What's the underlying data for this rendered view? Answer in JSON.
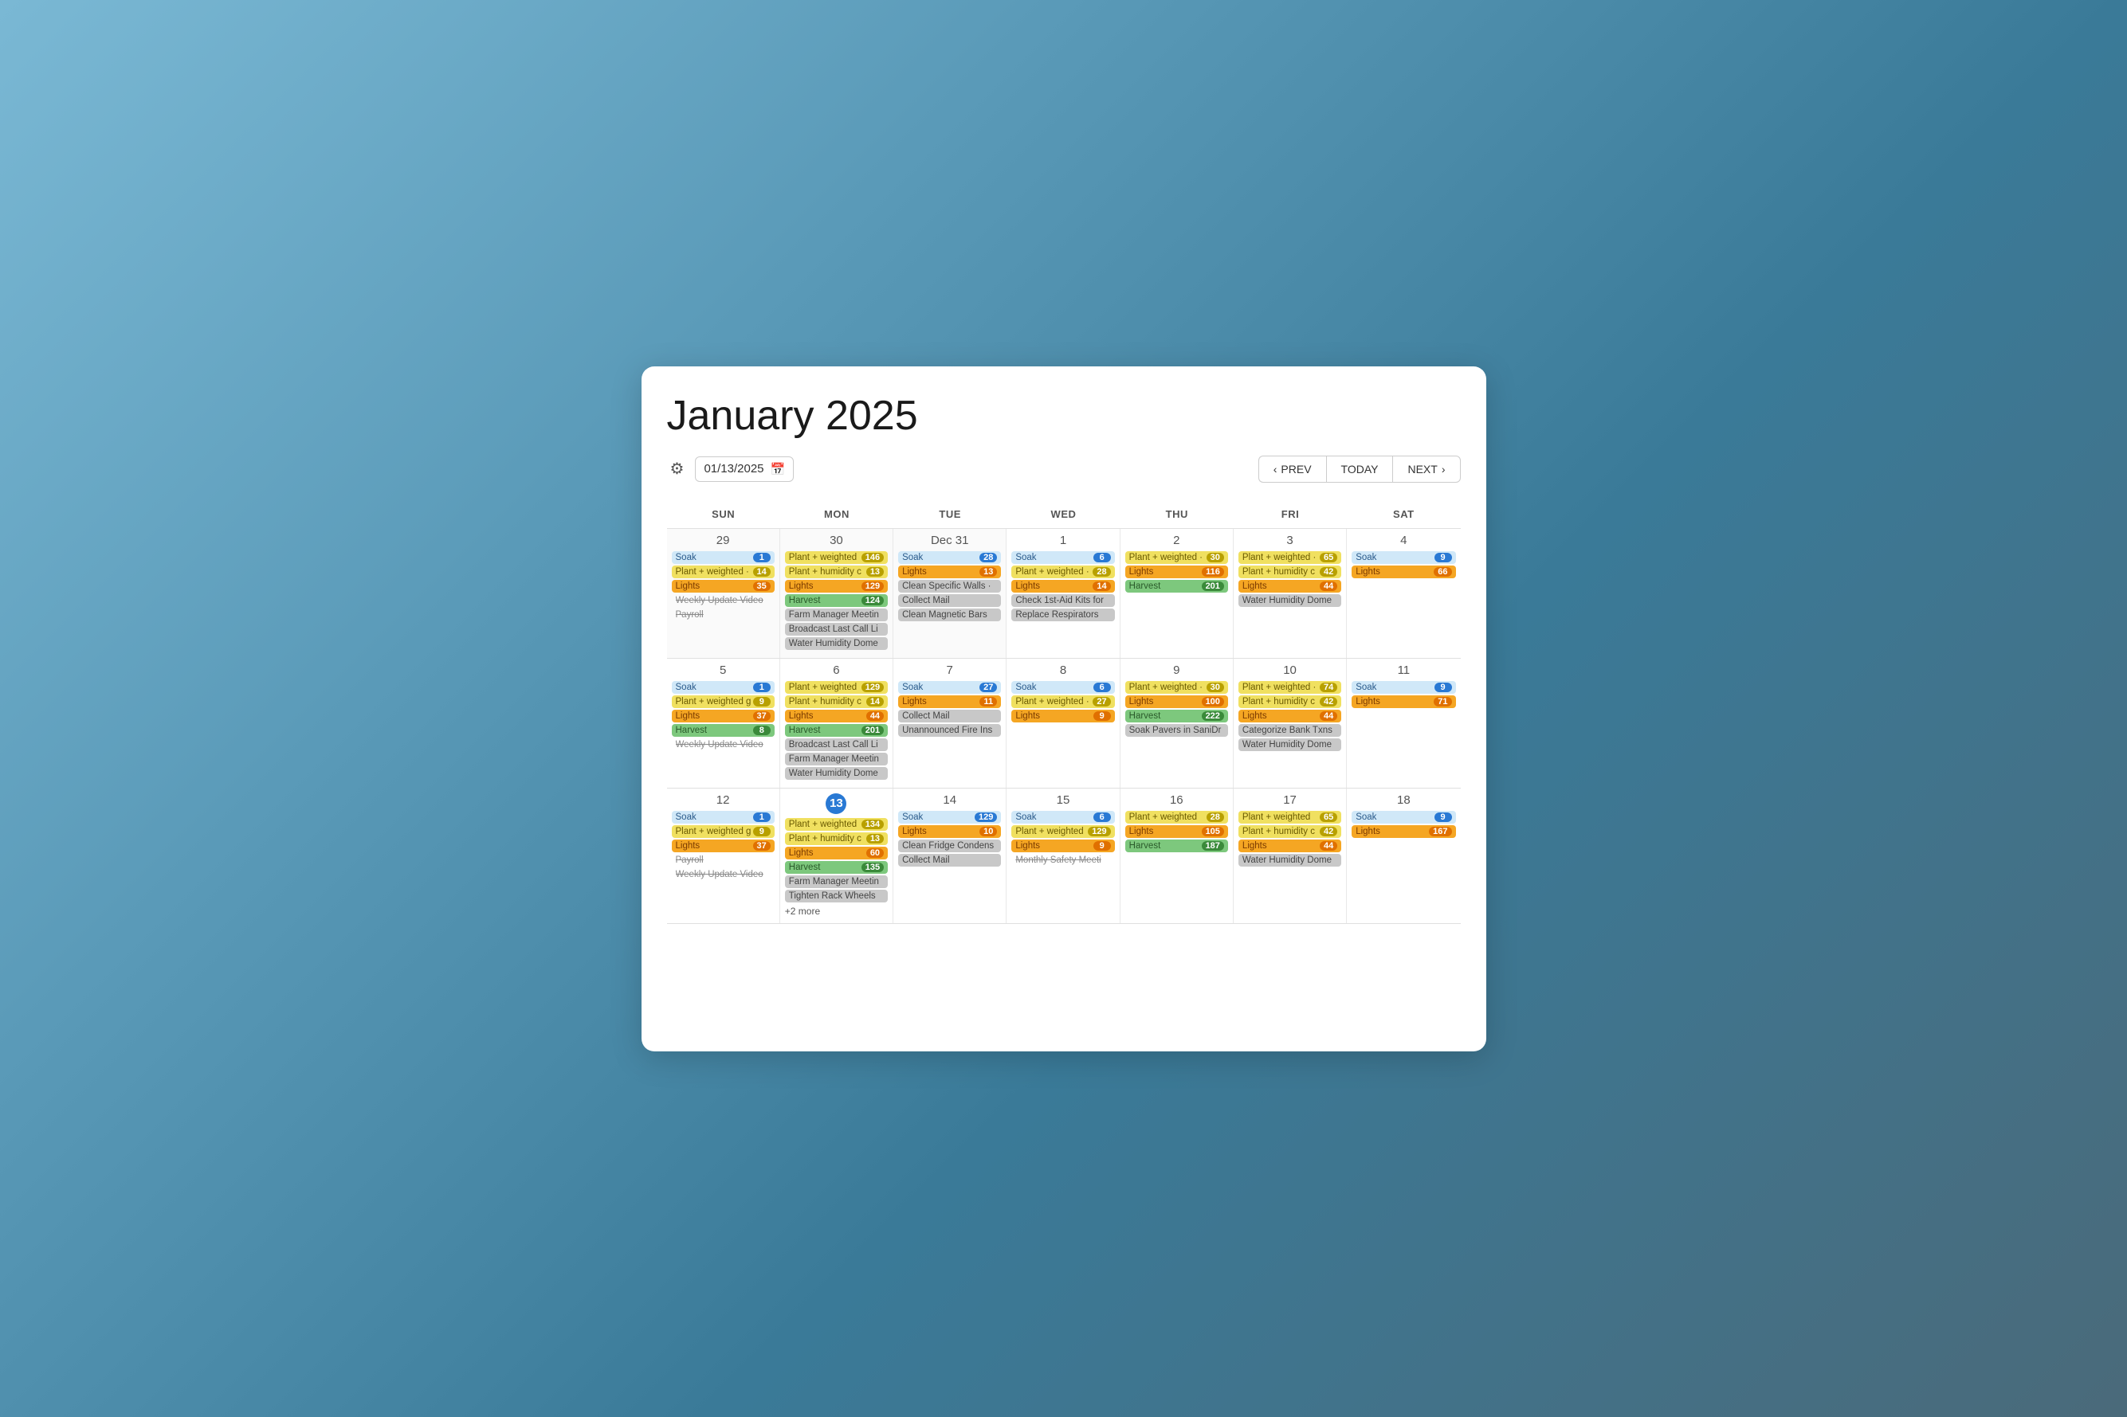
{
  "header": {
    "title": "January 2025",
    "date_input": "01/13/2025",
    "prev_label": "PREV",
    "today_label": "TODAY",
    "next_label": "NEXT"
  },
  "day_headers": [
    "SUN",
    "MON",
    "TUE",
    "WED",
    "THU",
    "FRI",
    "SAT"
  ],
  "weeks": [
    {
      "days": [
        {
          "num": "29",
          "other": true,
          "events": [
            {
              "name": "Soak",
              "badge": "1",
              "color": "blue",
              "badge_color": "blue-badge"
            },
            {
              "name": "Plant + weighted ·",
              "badge": "14",
              "color": "yellow",
              "badge_color": "yellow-badge"
            },
            {
              "name": "Lights",
              "badge": "35",
              "color": "orange",
              "badge_color": "orange-badge"
            },
            {
              "name": "Weekly Update Video",
              "badge": "",
              "color": "gray-text",
              "badge_color": ""
            },
            {
              "name": "Payroll",
              "badge": "",
              "color": "gray-text",
              "badge_color": ""
            }
          ]
        },
        {
          "num": "30",
          "other": true,
          "events": [
            {
              "name": "Plant + weighted",
              "badge": "146",
              "color": "yellow",
              "badge_color": "yellow-badge"
            },
            {
              "name": "Plant + humidity c",
              "badge": "13",
              "color": "yellow",
              "badge_color": "yellow-badge"
            },
            {
              "name": "Lights",
              "badge": "129",
              "color": "orange",
              "badge_color": "orange-badge"
            },
            {
              "name": "Harvest",
              "badge": "124",
              "color": "green",
              "badge_color": "green-badge"
            },
            {
              "name": "Farm Manager Meetin",
              "badge": "",
              "color": "gray",
              "badge_color": ""
            },
            {
              "name": "Broadcast Last Call Li",
              "badge": "",
              "color": "gray",
              "badge_color": ""
            },
            {
              "name": "Water Humidity Dome",
              "badge": "",
              "color": "gray",
              "badge_color": ""
            }
          ]
        },
        {
          "num": "Dec 31",
          "other": true,
          "events": [
            {
              "name": "Soak",
              "badge": "28",
              "color": "blue",
              "badge_color": "blue-badge"
            },
            {
              "name": "Lights",
              "badge": "13",
              "color": "orange",
              "badge_color": "orange-badge"
            },
            {
              "name": "Clean Specific Walls ·",
              "badge": "",
              "color": "gray",
              "badge_color": ""
            },
            {
              "name": "Collect Mail",
              "badge": "",
              "color": "gray",
              "badge_color": ""
            },
            {
              "name": "Clean Magnetic Bars",
              "badge": "",
              "color": "gray",
              "badge_color": ""
            }
          ]
        },
        {
          "num": "1",
          "other": false,
          "events": [
            {
              "name": "Soak",
              "badge": "6",
              "color": "blue",
              "badge_color": "blue-badge"
            },
            {
              "name": "Plant + weighted ·",
              "badge": "28",
              "color": "yellow",
              "badge_color": "yellow-badge"
            },
            {
              "name": "Lights",
              "badge": "14",
              "color": "orange",
              "badge_color": "orange-badge"
            },
            {
              "name": "Check 1st-Aid Kits for",
              "badge": "",
              "color": "gray",
              "badge_color": ""
            },
            {
              "name": "Replace Respirators",
              "badge": "",
              "color": "gray",
              "badge_color": ""
            }
          ]
        },
        {
          "num": "2",
          "other": false,
          "events": [
            {
              "name": "Plant + weighted ·",
              "badge": "30",
              "color": "yellow",
              "badge_color": "yellow-badge"
            },
            {
              "name": "Lights",
              "badge": "116",
              "color": "orange",
              "badge_color": "orange-badge"
            },
            {
              "name": "Harvest",
              "badge": "201",
              "color": "green",
              "badge_color": "green-badge"
            }
          ]
        },
        {
          "num": "3",
          "other": false,
          "events": [
            {
              "name": "Plant + weighted ·",
              "badge": "65",
              "color": "yellow",
              "badge_color": "yellow-badge"
            },
            {
              "name": "Plant + humidity c",
              "badge": "42",
              "color": "yellow",
              "badge_color": "yellow-badge"
            },
            {
              "name": "Lights",
              "badge": "44",
              "color": "orange",
              "badge_color": "orange-badge"
            },
            {
              "name": "Water Humidity Dome",
              "badge": "",
              "color": "gray",
              "badge_color": ""
            }
          ]
        },
        {
          "num": "4",
          "other": false,
          "events": [
            {
              "name": "Soak",
              "badge": "9",
              "color": "blue",
              "badge_color": "blue-badge"
            },
            {
              "name": "Lights",
              "badge": "66",
              "color": "orange",
              "badge_color": "orange-badge"
            }
          ]
        }
      ]
    },
    {
      "days": [
        {
          "num": "5",
          "other": false,
          "events": [
            {
              "name": "Soak",
              "badge": "1",
              "color": "blue",
              "badge_color": "blue-badge"
            },
            {
              "name": "Plant + weighted g",
              "badge": "9",
              "color": "yellow",
              "badge_color": "yellow-badge"
            },
            {
              "name": "Lights",
              "badge": "37",
              "color": "orange",
              "badge_color": "orange-badge"
            },
            {
              "name": "Harvest",
              "badge": "8",
              "color": "green",
              "badge_color": "green-badge"
            },
            {
              "name": "Weekly Update Video",
              "badge": "",
              "color": "gray-text",
              "badge_color": ""
            }
          ]
        },
        {
          "num": "6",
          "other": false,
          "events": [
            {
              "name": "Plant + weighted",
              "badge": "129",
              "color": "yellow",
              "badge_color": "yellow-badge"
            },
            {
              "name": "Plant + humidity c",
              "badge": "14",
              "color": "yellow",
              "badge_color": "yellow-badge"
            },
            {
              "name": "Lights",
              "badge": "44",
              "color": "orange",
              "badge_color": "orange-badge"
            },
            {
              "name": "Harvest",
              "badge": "201",
              "color": "green",
              "badge_color": "green-badge"
            },
            {
              "name": "Broadcast Last Call Li",
              "badge": "",
              "color": "gray",
              "badge_color": ""
            },
            {
              "name": "Farm Manager Meetin",
              "badge": "",
              "color": "gray",
              "badge_color": ""
            },
            {
              "name": "Water Humidity Dome",
              "badge": "",
              "color": "gray",
              "badge_color": ""
            }
          ]
        },
        {
          "num": "7",
          "other": false,
          "events": [
            {
              "name": "Soak",
              "badge": "27",
              "color": "blue",
              "badge_color": "blue-badge"
            },
            {
              "name": "Lights",
              "badge": "11",
              "color": "orange",
              "badge_color": "orange-badge"
            },
            {
              "name": "Collect Mail",
              "badge": "",
              "color": "gray",
              "badge_color": ""
            },
            {
              "name": "Unannounced Fire Ins",
              "badge": "",
              "color": "gray",
              "badge_color": ""
            }
          ]
        },
        {
          "num": "8",
          "other": false,
          "events": [
            {
              "name": "Soak",
              "badge": "6",
              "color": "blue",
              "badge_color": "blue-badge"
            },
            {
              "name": "Plant + weighted ·",
              "badge": "27",
              "color": "yellow",
              "badge_color": "yellow-badge"
            },
            {
              "name": "Lights",
              "badge": "9",
              "color": "orange",
              "badge_color": "orange-badge"
            }
          ]
        },
        {
          "num": "9",
          "other": false,
          "events": [
            {
              "name": "Plant + weighted ·",
              "badge": "30",
              "color": "yellow",
              "badge_color": "yellow-badge"
            },
            {
              "name": "Lights",
              "badge": "100",
              "color": "orange",
              "badge_color": "orange-badge"
            },
            {
              "name": "Harvest",
              "badge": "222",
              "color": "green",
              "badge_color": "green-badge"
            },
            {
              "name": "Soak Pavers in SaniDr",
              "badge": "",
              "color": "gray",
              "badge_color": ""
            }
          ]
        },
        {
          "num": "10",
          "other": false,
          "events": [
            {
              "name": "Plant + weighted ·",
              "badge": "74",
              "color": "yellow",
              "badge_color": "yellow-badge"
            },
            {
              "name": "Plant + humidity c",
              "badge": "42",
              "color": "yellow",
              "badge_color": "yellow-badge"
            },
            {
              "name": "Lights",
              "badge": "44",
              "color": "orange",
              "badge_color": "orange-badge"
            },
            {
              "name": "Categorize Bank Txns",
              "badge": "",
              "color": "gray",
              "badge_color": ""
            },
            {
              "name": "Water Humidity Dome",
              "badge": "",
              "color": "gray",
              "badge_color": ""
            }
          ]
        },
        {
          "num": "11",
          "other": false,
          "events": [
            {
              "name": "Soak",
              "badge": "9",
              "color": "blue",
              "badge_color": "blue-badge"
            },
            {
              "name": "Lights",
              "badge": "71",
              "color": "orange",
              "badge_color": "orange-badge"
            }
          ]
        }
      ]
    },
    {
      "days": [
        {
          "num": "12",
          "other": false,
          "events": [
            {
              "name": "Soak",
              "badge": "1",
              "color": "blue",
              "badge_color": "blue-badge"
            },
            {
              "name": "Plant + weighted g",
              "badge": "9",
              "color": "yellow",
              "badge_color": "yellow-badge"
            },
            {
              "name": "Lights",
              "badge": "37",
              "color": "orange",
              "badge_color": "orange-badge"
            },
            {
              "name": "Payroll",
              "badge": "",
              "color": "gray-text",
              "badge_color": ""
            },
            {
              "name": "Weekly Update Video",
              "badge": "",
              "color": "gray-text",
              "badge_color": ""
            }
          ]
        },
        {
          "num": "13",
          "today": true,
          "other": false,
          "events": [
            {
              "name": "Plant + weighted",
              "badge": "134",
              "color": "yellow",
              "badge_color": "yellow-badge"
            },
            {
              "name": "Plant + humidity c",
              "badge": "13",
              "color": "yellow",
              "badge_color": "yellow-badge"
            },
            {
              "name": "Lights",
              "badge": "60",
              "color": "orange",
              "badge_color": "orange-badge"
            },
            {
              "name": "Harvest",
              "badge": "135",
              "color": "green",
              "badge_color": "green-badge"
            },
            {
              "name": "Farm Manager Meetin",
              "badge": "",
              "color": "gray",
              "badge_color": ""
            },
            {
              "name": "Tighten Rack Wheels",
              "badge": "",
              "color": "gray",
              "badge_color": ""
            },
            {
              "name": "+2 more",
              "badge": "",
              "color": "more",
              "badge_color": ""
            }
          ]
        },
        {
          "num": "14",
          "other": false,
          "events": [
            {
              "name": "Soak",
              "badge": "129",
              "color": "blue",
              "badge_color": "blue-badge"
            },
            {
              "name": "Lights",
              "badge": "10",
              "color": "orange",
              "badge_color": "orange-badge"
            },
            {
              "name": "Clean Fridge Condens",
              "badge": "",
              "color": "gray",
              "badge_color": ""
            },
            {
              "name": "Collect Mail",
              "badge": "",
              "color": "gray",
              "badge_color": ""
            }
          ]
        },
        {
          "num": "15",
          "other": false,
          "events": [
            {
              "name": "Soak",
              "badge": "6",
              "color": "blue",
              "badge_color": "blue-badge"
            },
            {
              "name": "Plant + weighted",
              "badge": "129",
              "color": "yellow",
              "badge_color": "yellow-badge"
            },
            {
              "name": "Lights",
              "badge": "9",
              "color": "orange",
              "badge_color": "orange-badge"
            },
            {
              "name": "Monthly Safety Meeti",
              "badge": "",
              "color": "gray-text",
              "badge_color": ""
            }
          ]
        },
        {
          "num": "16",
          "other": false,
          "events": [
            {
              "name": "Plant + weighted",
              "badge": "28",
              "color": "yellow",
              "badge_color": "yellow-badge"
            },
            {
              "name": "Lights",
              "badge": "105",
              "color": "orange",
              "badge_color": "orange-badge"
            },
            {
              "name": "Harvest",
              "badge": "187",
              "color": "green",
              "badge_color": "green-badge"
            }
          ]
        },
        {
          "num": "17",
          "other": false,
          "events": [
            {
              "name": "Plant + weighted",
              "badge": "65",
              "color": "yellow",
              "badge_color": "yellow-badge"
            },
            {
              "name": "Plant + humidity c",
              "badge": "42",
              "color": "yellow",
              "badge_color": "yellow-badge"
            },
            {
              "name": "Lights",
              "badge": "44",
              "color": "orange",
              "badge_color": "orange-badge"
            },
            {
              "name": "Water Humidity Dome",
              "badge": "",
              "color": "gray",
              "badge_color": ""
            }
          ]
        },
        {
          "num": "18",
          "other": false,
          "events": [
            {
              "name": "Soak",
              "badge": "9",
              "color": "blue",
              "badge_color": "blue-badge"
            },
            {
              "name": "Lights",
              "badge": "167",
              "color": "orange",
              "badge_color": "orange-badge"
            }
          ]
        }
      ]
    }
  ]
}
